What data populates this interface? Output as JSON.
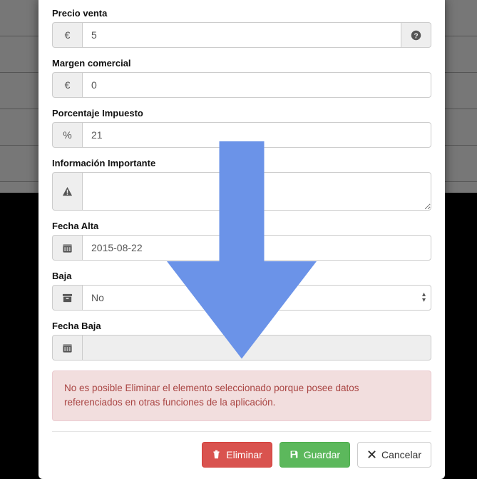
{
  "fields": {
    "precio_venta": {
      "label": "Precio venta",
      "value": "5"
    },
    "margen": {
      "label": "Margen comercial",
      "value": "0"
    },
    "porcentaje": {
      "label": "Porcentaje Impuesto",
      "value": "21"
    },
    "info": {
      "label": "Información Importante",
      "value": ""
    },
    "fecha_alta": {
      "label": "Fecha Alta",
      "value": "2015-08-22"
    },
    "baja": {
      "label": "Baja",
      "value": "No"
    },
    "fecha_baja": {
      "label": "Fecha Baja",
      "value": ""
    }
  },
  "alert": {
    "text": "No es posible Eliminar el elemento seleccionado porque posee datos referenciados en otras funciones de la aplicación."
  },
  "buttons": {
    "delete": "Eliminar",
    "save": "Guardar",
    "cancel": "Cancelar"
  },
  "symbols": {
    "euro": "€",
    "percent": "%"
  }
}
